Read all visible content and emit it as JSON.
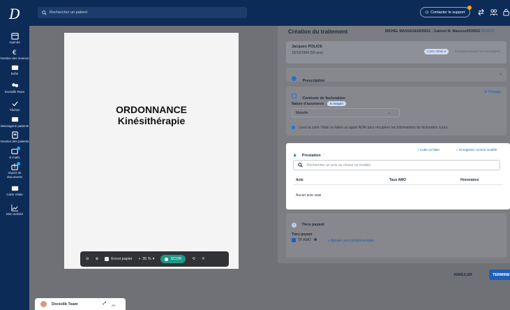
{
  "topbar": {
    "search_placeholder": "Rechercher un patient",
    "support_label": "Contacter le support"
  },
  "sidebar": {
    "logo": "D",
    "items": [
      {
        "label": "Agenda",
        "icon": "calendar-icon"
      },
      {
        "label": "Gestion des revenus",
        "icon": "euro-icon"
      },
      {
        "label": "Boîte",
        "icon": "mail-icon"
      },
      {
        "label": "Doctolib Team",
        "icon": "team-icon"
      },
      {
        "label": "Tâches",
        "icon": "check-icon"
      },
      {
        "label": "Messagerie patients",
        "icon": "chat-icon"
      },
      {
        "label": "Gestion des patients",
        "icon": "patient-file-icon"
      },
      {
        "label": "E-mails",
        "icon": "email-icon"
      },
      {
        "label": "Import de documents",
        "icon": "import-icon"
      },
      {
        "label": "Carte Vitale",
        "icon": "card-icon"
      },
      {
        "label": "Mon activité",
        "icon": "chart-icon"
      }
    ]
  },
  "document": {
    "title_line1": "ORDONNANCE",
    "title_line2": "Kinésithérapie",
    "toolbar": {
      "paper_label": "Envoi papier",
      "zoom": "35 %",
      "scor_label": "SCOR"
    }
  },
  "team_bar": {
    "label": "Doctolib Team"
  },
  "panel": {
    "title": "Création du traitement",
    "practitioner": "MICHEL MASSAGE0039522 - Cabinet M. Masseur0039522",
    "practitioner_link": "0039522",
    "patient": {
      "name": "Jacques POLICE",
      "dob": "10/10/1964 (59 ans)",
      "card_pill": "Carte Vitale",
      "complementary": "Complémentaire non renseignée"
    },
    "prescription": {
      "title": "Prescription"
    },
    "billing": {
      "title": "Contexte de facturation",
      "forcing": "Forçage",
      "insurance_label": "Nature d'assurance",
      "to_fill": "À remplir",
      "insurance_value": "Maladie",
      "info": "Lisez la carte Vitale ou faites un appel ADRi pour récupérer les informations de facturation à jour."
    },
    "prestation": {
      "title": "Prestation",
      "quote_bilan": "Coter un bilan",
      "save_model": "Enregistrer comme modèle",
      "search_placeholder": "Rechercher un acte ou choisir un modèle",
      "columns": [
        "Acte",
        "Taux AMO",
        "Honoraires"
      ],
      "empty": "Aucun acte saisi"
    },
    "tiers": {
      "title": "Tiers payant",
      "label": "Tiers payant",
      "tp_amo": "TP AMO",
      "add_complementary": "Ajouter une complémentaire"
    },
    "footer": {
      "cancel": "ANNULER",
      "finish": "TERMINER"
    }
  },
  "colors": {
    "navy": "#0d2b57",
    "accent": "#1f5fb5",
    "teal": "#1b9a87"
  }
}
